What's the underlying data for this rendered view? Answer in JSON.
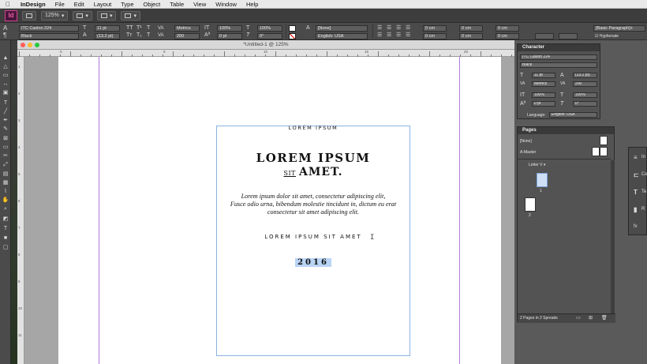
{
  "menubar": {
    "app_name": "InDesign",
    "items": [
      "File",
      "Edit",
      "Layout",
      "Type",
      "Object",
      "Table",
      "View",
      "Window",
      "Help"
    ]
  },
  "appbar": {
    "logo": "Id",
    "zoom": "125%"
  },
  "control_panel": {
    "font_family": "ITC Caslon 224",
    "font_style": "Black",
    "font_size": "11 pt",
    "leading": "(13.2 pt)",
    "kerning": "Metrics",
    "tracking": "200",
    "vertical_scale": "100%",
    "horizontal_scale": "100%",
    "baseline_shift": "0 pt",
    "skew": "0°",
    "character_style": "[None]",
    "language": "English: USA",
    "indent_1": "0 cm",
    "indent_2": "0 cm",
    "indent_3": "0 cm",
    "indent_4": "0 cm",
    "space_1": "0 cm",
    "space_2": "0 cm",
    "paragraph_style": "[Basic Paragraph]+",
    "hyphenate": "Hyphenate"
  },
  "document": {
    "tab_title": "*Untitled-1 @ 125%",
    "ruler_top": [
      "0",
      "5",
      "10",
      "15",
      "20"
    ],
    "ruler_left": [
      "1",
      "2",
      "3",
      "4",
      "5",
      "6",
      "7",
      "8",
      "9",
      "10",
      "11"
    ],
    "text": {
      "header": "LOREM IPSUM",
      "title_line1": "LOREM IPSUM",
      "title_small": "SIT",
      "title_line2": "AMET.",
      "body_line1": "Lorem ipsum dolor sit amet, consectetur adipiscing elit,",
      "body_line2": "Fusce odio urna, bibendum molestie tincidunt in, dictum eu erat",
      "body_line3": "consectetur sit amet adipiscing elit.",
      "subtitle": "LOREM IPSUM SIT AMET",
      "year": "2016"
    }
  },
  "character_panel": {
    "title": "Character",
    "font_family": "ITC Caslon 224",
    "font_style": "Black",
    "size": "11 pt",
    "leading": "(13.2 pt)",
    "kerning": "Metrics",
    "tracking": "200",
    "vscale": "100%",
    "hscale": "100%",
    "baseline": "0 pt",
    "skew": "0°",
    "language_label": "Language:",
    "language": "English: USA"
  },
  "pages_panel": {
    "title": "Pages",
    "none_master": "[None]",
    "a_master": "A-Master",
    "size_label": "Letter V",
    "page1": "1",
    "page2": "2",
    "status": "2 Pages in 2 Spreads"
  },
  "collapsed_panel": {
    "items": [
      "In",
      "Ce",
      "Te",
      "R",
      "fx"
    ]
  },
  "colors": {
    "accent_selection": "#b9d4f5",
    "frame_border": "#8bb3e0",
    "guide": "#b57ad8",
    "app_logo": "#e55ba3"
  }
}
